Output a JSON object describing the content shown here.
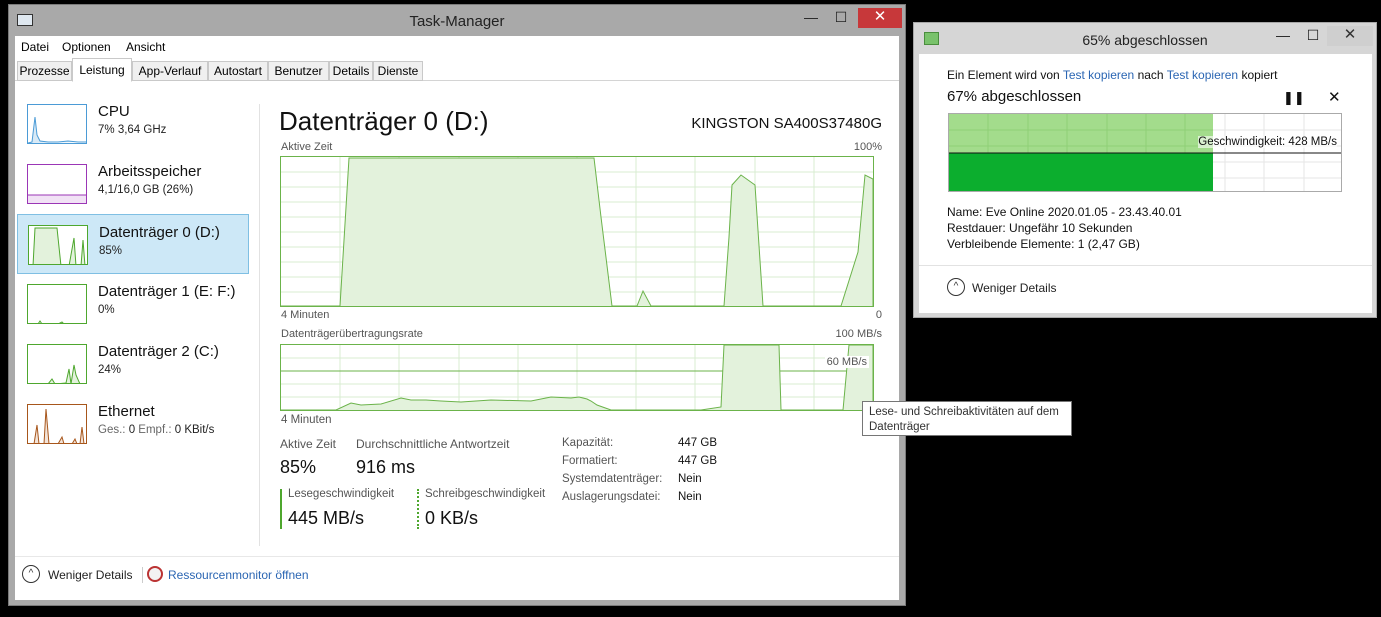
{
  "taskmanager": {
    "title": "Task-Manager",
    "menu": [
      "Datei",
      "Optionen",
      "Ansicht"
    ],
    "tabs": [
      "Prozesse",
      "Leistung",
      "App-Verlauf",
      "Autostart",
      "Benutzer",
      "Details",
      "Dienste"
    ],
    "active_tab": "Leistung",
    "sidebar": [
      {
        "name": "CPU",
        "sub": "7% 3,64 GHz",
        "color": "#4b9bd6"
      },
      {
        "name": "Arbeitsspeicher",
        "sub": "4,1/16,0 GB (26%)",
        "color": "#9b36b6"
      },
      {
        "name": "Datenträger 0 (D:)",
        "sub": "85%",
        "color": "#4ea72e"
      },
      {
        "name": "Datenträger 1 (E: F:)",
        "sub": "0%",
        "color": "#4ea72e"
      },
      {
        "name": "Datenträger 2 (C:)",
        "sub": "24%",
        "color": "#4ea72e"
      },
      {
        "name": "Ethernet",
        "sub_prefix_send": "Ges.:",
        "sub_send": "0",
        "sub_prefix_recv": "Empf.:",
        "sub_recv": "0 KBit/s",
        "color": "#a7561b"
      }
    ],
    "selected_index": 2,
    "disk": {
      "title": "Datenträger 0 (D:)",
      "model": "KINGSTON SA400S37480G",
      "graph1_label": "Aktive Zeit",
      "graph1_max": "100%",
      "graph1_time": "4 Minuten",
      "graph1_min": "0",
      "graph2_label": "Datenträgerübertragungsrate",
      "graph2_max": "100 MB/s",
      "graph2_mid": "60 MB/s",
      "graph2_time": "4 Minuten",
      "active_time_label": "Aktive Zeit",
      "active_time_value": "85%",
      "response_label": "Durchschnittliche Antwortzeit",
      "response_value": "916 ms",
      "read_label": "Lesegeschwindigkeit",
      "read_value": "445 MB/s",
      "write_label": "Schreibgeschwindigkeit",
      "write_value": "0 KB/s",
      "properties": [
        {
          "key": "Kapazität:",
          "value": "447 GB"
        },
        {
          "key": "Formatiert:",
          "value": "447 GB"
        },
        {
          "key": "Systemdatenträger:",
          "value": "Nein"
        },
        {
          "key": "Auslagerungsdatei:",
          "value": "Nein"
        }
      ]
    },
    "footer": {
      "less_details": "Weniger Details",
      "resource_monitor": "Ressourcenmonitor öffnen"
    },
    "tooltip": "Lese- und Schreibaktivitäten auf dem Datenträger"
  },
  "copy_dialog": {
    "title": "65% abgeschlossen",
    "line_prefix": "Ein Element wird von",
    "source": "Test kopieren",
    "line_mid": "nach",
    "target": "Test kopieren",
    "line_suffix": "kopiert",
    "progress_text": "67% abgeschlossen",
    "progress_fraction": 0.67,
    "speed_label": "Geschwindigkeit: 428 MB/s",
    "name_label": "Name:",
    "name_value": "Eve Online 2020.01.05 - 23.43.40.01",
    "remaining_label": "Restdauer:",
    "remaining_value": "Ungefähr 10 Sekunden",
    "items_label": "Verbleibende Elemente:",
    "items_value": "1 (2,47 GB)",
    "less_details": "Weniger Details"
  }
}
